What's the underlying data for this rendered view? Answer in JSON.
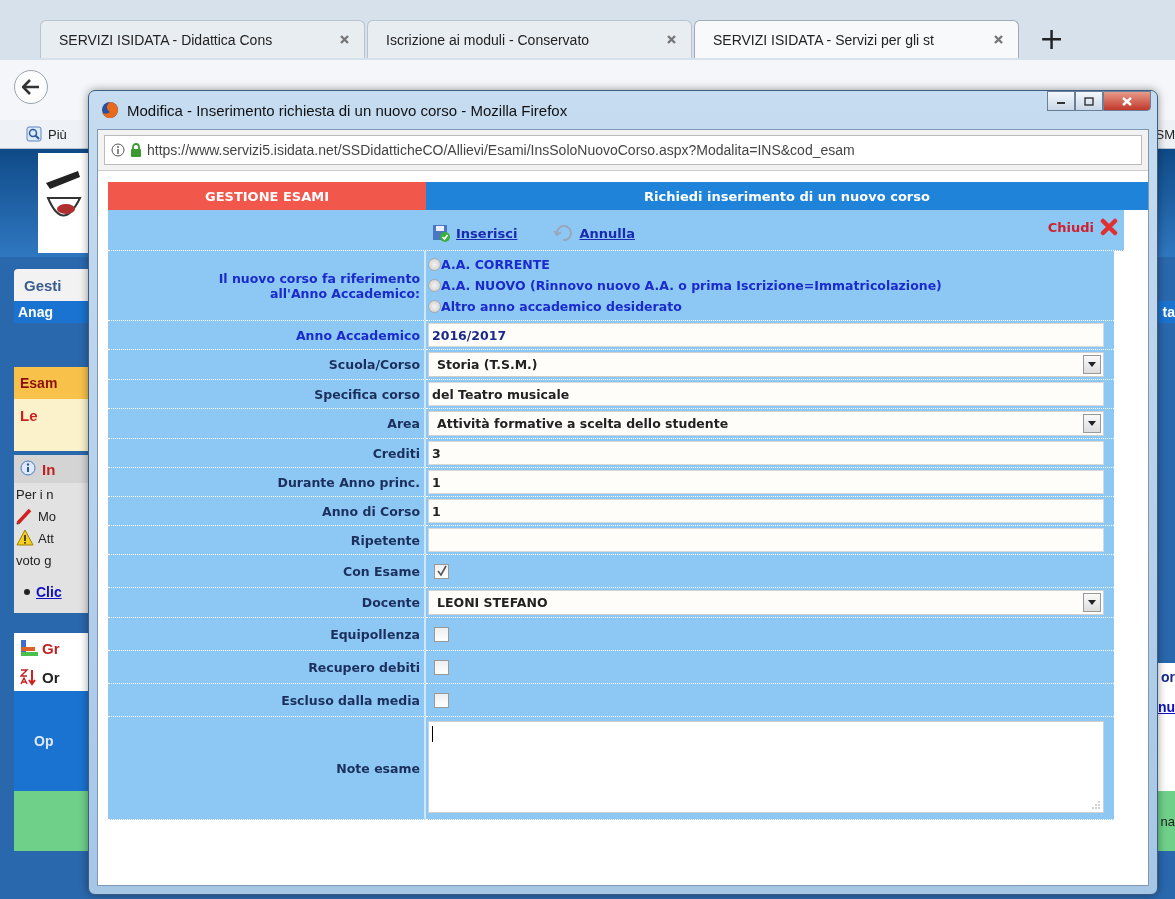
{
  "browser": {
    "tabs": [
      {
        "label": "SERVIZI ISIDATA - Didattica Cons",
        "selected": false
      },
      {
        "label": "Iscrizione ai moduli - Conservato",
        "selected": false
      },
      {
        "label": "SERVIZI ISIDATA - Servizi per gli st",
        "selected": true
      }
    ],
    "new_tab": "+",
    "bookmarks": {
      "left": "Più",
      "right": "SM"
    }
  },
  "background_rows": [
    {
      "kind": "tab",
      "left": "Gesti"
    },
    {
      "kind": "bar",
      "left": "Anag",
      "right": "ta"
    },
    {
      "kind": "header",
      "left": "Esam"
    },
    {
      "kind": "tool",
      "left": "Le"
    },
    {
      "kind": "info",
      "left": "In"
    },
    {
      "kind": "text",
      "left": "Per i n"
    },
    {
      "kind": "edit",
      "left": "Mo"
    },
    {
      "kind": "warning",
      "left": "Att"
    },
    {
      "kind": "text",
      "left": "voto g"
    },
    {
      "kind": "link",
      "left": "Clic"
    },
    {
      "kind": "chart",
      "left": "Gr"
    },
    {
      "kind": "sort",
      "left": "Or",
      "right": "or"
    },
    {
      "kind": "table_head",
      "left": "Op",
      "right": "nu"
    },
    {
      "kind": "green",
      "right": "na"
    }
  ],
  "popup": {
    "title": "Modifica - Inserimento richiesta di un nuovo corso - Mozilla Firefox",
    "url": "https://www.servizi5.isidata.net/SSDidatticheCO/Allievi/Esami/InsSoloNuovoCorso.aspx?Modalita=INS&cod_esam",
    "section": "GESTIONE ESAMI",
    "heading": "Richiedi inserimento di un nuovo corso",
    "actions": [
      {
        "kind": "save",
        "label": "Inserisci"
      },
      {
        "kind": "undo",
        "label": "Annulla"
      },
      {
        "kind": "close",
        "label": "Chiudi"
      }
    ],
    "form": [
      {
        "kind": "radio",
        "label": "Il nuovo corso fa riferimento all'Anno Accademico:",
        "options": [
          {
            "label": "A.A. CORRENTE",
            "selected": false
          },
          {
            "label": "A.A. NUOVO (Rinnovo nuovo A.A. o prima Iscrizione=Immatricolazione)",
            "selected": false
          },
          {
            "label": "Altro anno accademico desiderato",
            "selected": false
          }
        ]
      },
      {
        "kind": "text",
        "label": "Anno Accademico",
        "value": "2016/2017",
        "accent": true
      },
      {
        "kind": "select",
        "label": "Scuola/Corso",
        "value": "Storia (T.S.M.)"
      },
      {
        "kind": "text",
        "label": "Specifica corso",
        "value": "del Teatro musicale"
      },
      {
        "kind": "select",
        "label": "Area",
        "value": "Attività formative a scelta dello studente"
      },
      {
        "kind": "text",
        "label": "Crediti",
        "value": "3"
      },
      {
        "kind": "text",
        "label": "Durante Anno princ.",
        "value": "1"
      },
      {
        "kind": "text",
        "label": "Anno di Corso",
        "value": "1"
      },
      {
        "kind": "text",
        "label": "Ripetente"
      },
      {
        "kind": "checkbox",
        "label": "Con Esame",
        "checked": true
      },
      {
        "kind": "select",
        "label": "Docente",
        "value": "LEONI STEFANO"
      },
      {
        "kind": "checkbox",
        "label": "Equipollenza",
        "checked": false
      },
      {
        "kind": "checkbox",
        "label": "Recupero debiti",
        "checked": false
      },
      {
        "kind": "checkbox",
        "label": "Escluso dalla media",
        "checked": false
      },
      {
        "kind": "textarea",
        "label": "Note esame"
      }
    ]
  }
}
